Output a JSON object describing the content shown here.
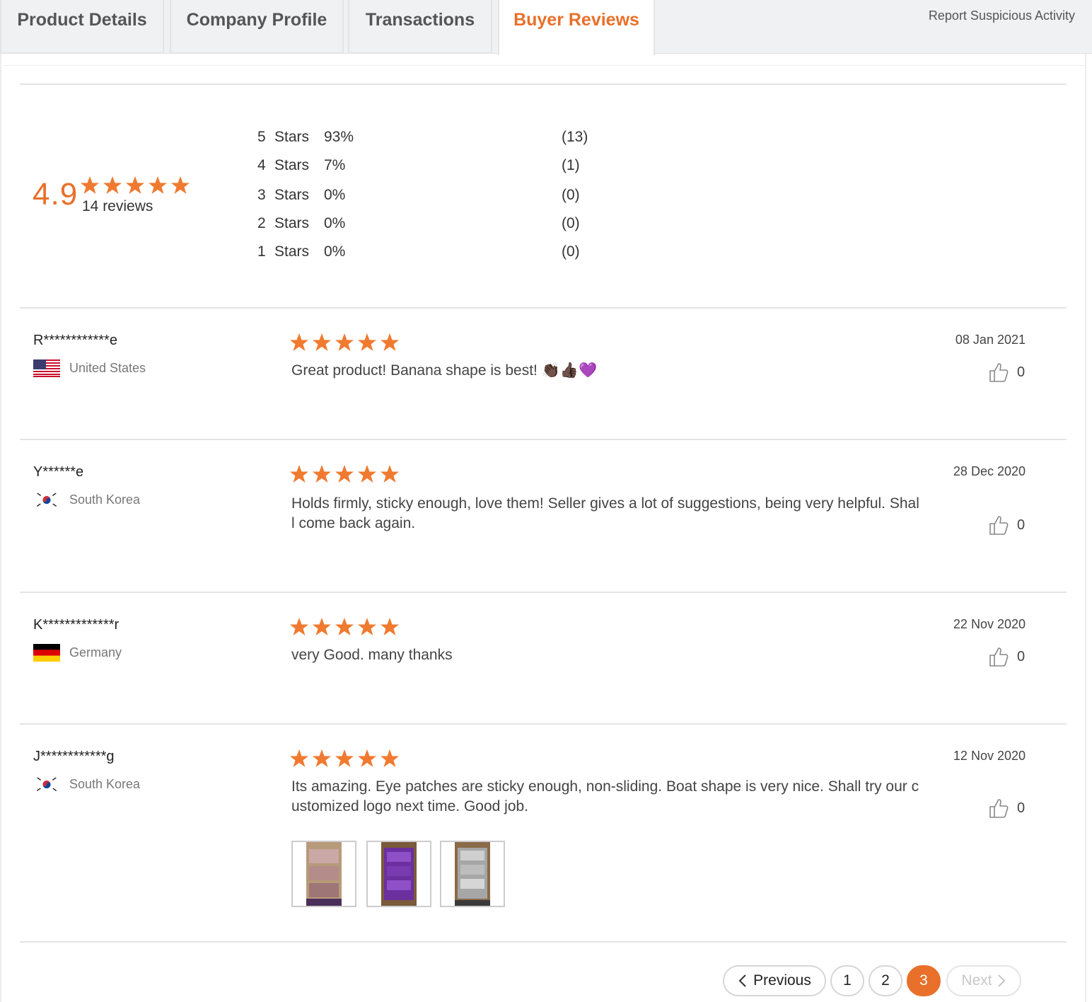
{
  "tabs": {
    "product_details": "Product Details",
    "company_profile": "Company Profile",
    "transactions": "Transactions",
    "buyer_reviews": "Buyer Reviews"
  },
  "report_link": "Report Suspicious Activity",
  "summary": {
    "average": "4.9",
    "reviews_label": "14 reviews",
    "distribution": [
      {
        "num": "5",
        "label": "Stars",
        "percent": "93%",
        "count": "(13)",
        "fraction": 0.93
      },
      {
        "num": "4",
        "label": "Stars",
        "percent": "7%",
        "count": "(1)",
        "fraction": 0.07
      },
      {
        "num": "3",
        "label": "Stars",
        "percent": "0%",
        "count": "(0)",
        "fraction": 0
      },
      {
        "num": "2",
        "label": "Stars",
        "percent": "0%",
        "count": "(0)",
        "fraction": 0
      },
      {
        "num": "1",
        "label": "Stars",
        "percent": "0%",
        "count": "(0)",
        "fraction": 0
      }
    ]
  },
  "reviews": [
    {
      "name": "R************e",
      "country": "United States",
      "rating": 5,
      "date": "08 Jan 2021",
      "text": "Great product! Banana shape is best! 👏🏿👍🏿💜",
      "likes": "0"
    },
    {
      "name": "Y******e",
      "country": "South Korea",
      "rating": 5,
      "date": "28 Dec 2020",
      "text": "Holds firmly, sticky enough, love them! Seller gives a lot of suggestions, being very helpful. Shall come back again.",
      "likes": "0"
    },
    {
      "name": "K*************r",
      "country": "Germany",
      "rating": 5,
      "date": "22 Nov 2020",
      "text": "very Good. many thanks",
      "likes": "0"
    },
    {
      "name": "J************g",
      "country": "South Korea",
      "rating": 5,
      "date": "12 Nov 2020",
      "text": "Its amazing. Eye patches are sticky enough, non-sliding. Boat shape is very nice. Shall try our customized logo next time. Good job.",
      "likes": "0"
    }
  ],
  "pagination": {
    "previous": "Previous",
    "pages": [
      "1",
      "2",
      "3"
    ],
    "current": "3",
    "next": "Next"
  },
  "colors": {
    "accent": "#e8702a",
    "star": "#f07a2f"
  }
}
